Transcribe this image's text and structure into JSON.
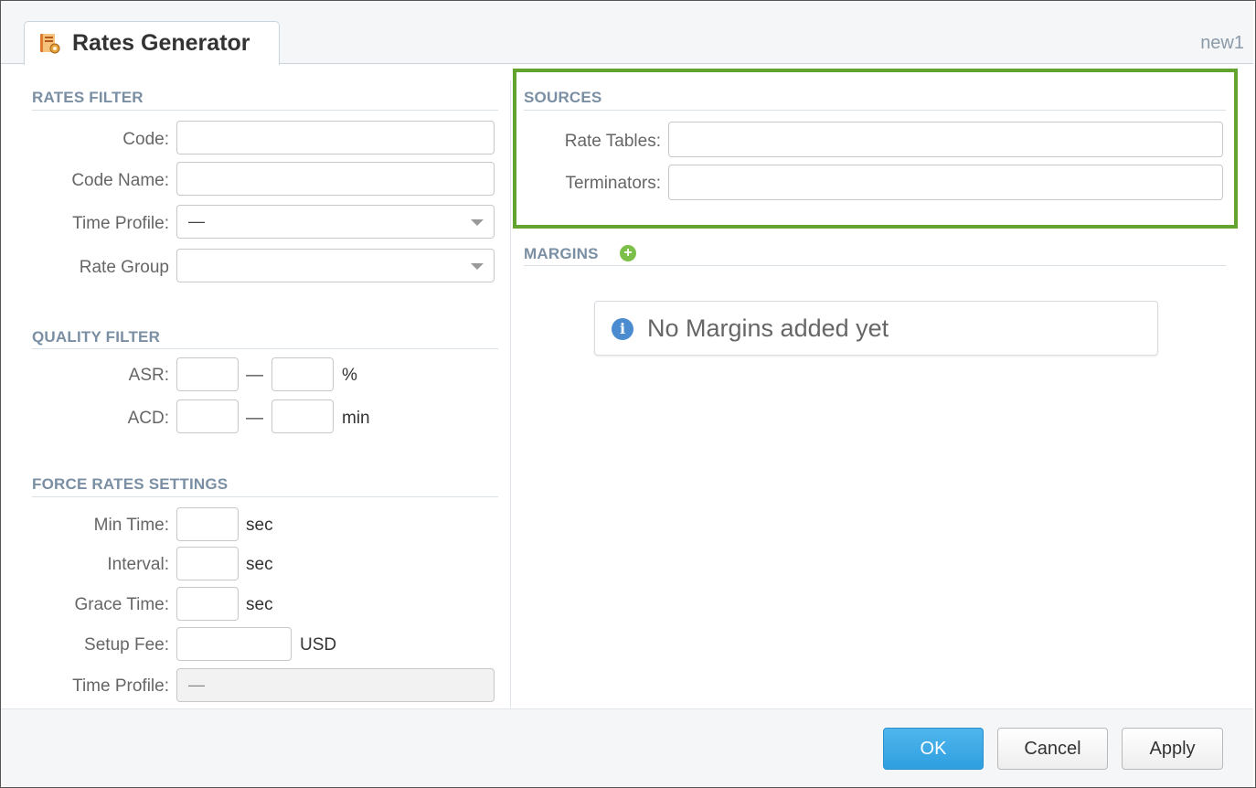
{
  "tab": {
    "title": "Rates Generator",
    "icon": "rates-generator-icon",
    "corner_label": "new1"
  },
  "rates_filter": {
    "title": "RATES FILTER",
    "code_label": "Code:",
    "code_value": "",
    "code_name_label": "Code Name:",
    "code_name_value": "",
    "time_profile_label": "Time Profile:",
    "time_profile_value": "—",
    "rate_group_label": "Rate Group",
    "rate_group_value": ""
  },
  "quality_filter": {
    "title": "QUALITY FILTER",
    "asr_label": "ASR:",
    "asr_unit": "%",
    "acd_label": "ACD:",
    "acd_unit": "min",
    "separator": "—"
  },
  "force_rates": {
    "title": "FORCE RATES SETTINGS",
    "min_time_label": "Min Time:",
    "min_time_unit": "sec",
    "interval_label": "Interval:",
    "interval_unit": "sec",
    "grace_time_label": "Grace Time:",
    "grace_time_unit": "sec",
    "setup_fee_label": "Setup Fee:",
    "setup_fee_unit": "USD",
    "time_profile_label": "Time Profile:",
    "time_profile_value": "—"
  },
  "sources": {
    "title": "SOURCES",
    "rate_tables_label": "Rate Tables:",
    "rate_tables_value": "",
    "terminators_label": "Terminators:",
    "terminators_value": "",
    "highlight_color": "#63a32f"
  },
  "margins": {
    "title": "MARGINS",
    "empty_message": "No Margins added yet"
  },
  "buttons": {
    "ok": "OK",
    "cancel": "Cancel",
    "apply": "Apply"
  },
  "colors": {
    "primary_button": "#2f9fe0",
    "section_title": "#7a8fa3",
    "add_icon": "#7cc04a",
    "info_icon": "#4a8ccf"
  }
}
